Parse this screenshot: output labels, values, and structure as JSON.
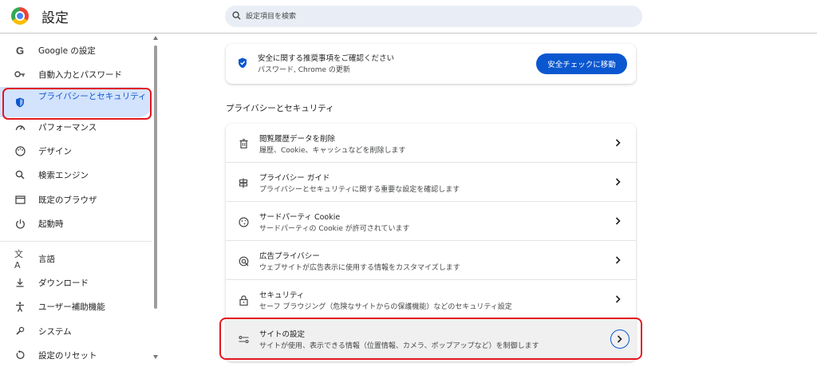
{
  "header": {
    "title": "設定",
    "search_placeholder": "設定項目を検索"
  },
  "sidebar": {
    "items": [
      {
        "label": "Google の設定",
        "icon": "google-icon"
      },
      {
        "label": "自動入力とパスワード",
        "icon": "key-icon"
      },
      {
        "label": "プライバシーとセキュリティ",
        "icon": "shield-icon",
        "active": true
      },
      {
        "label": "パフォーマンス",
        "icon": "speedometer-icon"
      },
      {
        "label": "デザイン",
        "icon": "palette-icon"
      },
      {
        "label": "検索エンジン",
        "icon": "search-icon"
      },
      {
        "label": "既定のブラウザ",
        "icon": "browser-window-icon"
      },
      {
        "label": "起動時",
        "icon": "power-icon"
      },
      {
        "label": "言語",
        "icon": "translate-icon"
      },
      {
        "label": "ダウンロード",
        "icon": "download-icon"
      },
      {
        "label": "ユーザー補助機能",
        "icon": "accessibility-icon"
      },
      {
        "label": "システム",
        "icon": "wrench-icon"
      },
      {
        "label": "設定のリセット",
        "icon": "reset-icon"
      }
    ]
  },
  "safety_check": {
    "title": "安全に関する推奨事項をご確認ください",
    "subtitle": "パスワード, Chrome の更新",
    "button_label": "安全チェックに移動"
  },
  "section": {
    "title": "プライバシーとセキュリティ"
  },
  "rows": [
    {
      "title": "閲覧履歴データを削除",
      "subtitle": "履歴、Cookie、キャッシュなどを削除します",
      "icon": "trash-icon"
    },
    {
      "title": "プライバシー ガイド",
      "subtitle": "プライバシーとセキュリティに関する重要な設定を確認します",
      "icon": "privacy-guide-icon"
    },
    {
      "title": "サードパーティ Cookie",
      "subtitle": "サードパーティの Cookie が許可されています",
      "icon": "cookie-icon"
    },
    {
      "title": "広告プライバシー",
      "subtitle": "ウェブサイトが広告表示に使用する情報をカスタマイズします",
      "icon": "ad-privacy-icon"
    },
    {
      "title": "セキュリティ",
      "subtitle": "セーフ ブラウジング（危険なサイトからの保護機能）などのセキュリティ設定",
      "icon": "lock-icon"
    },
    {
      "title": "サイトの設定",
      "subtitle": "サイトが使用、表示できる情報（位置情報、カメラ、ポップアップなど）を制御します",
      "icon": "sliders-icon",
      "selected": true
    }
  ],
  "colors": {
    "accent": "#0b57d0",
    "highlight": "#e3171f",
    "active_bg": "#d3e3fd"
  }
}
